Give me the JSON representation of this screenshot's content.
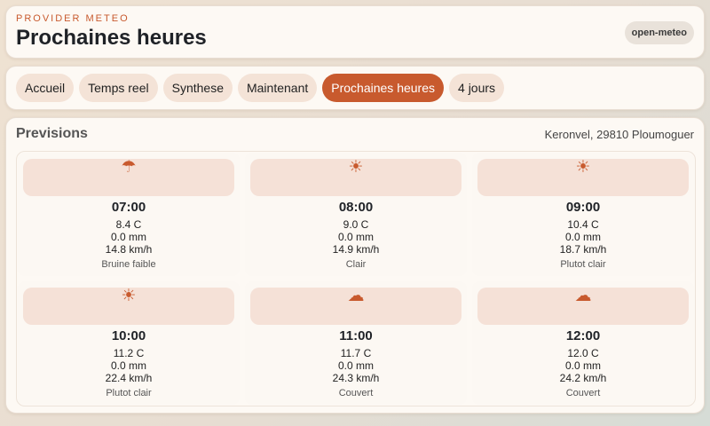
{
  "header": {
    "provider": "PROVIDER METEO",
    "title": "Prochaines heures",
    "badge": "open-meteo"
  },
  "nav": {
    "tabs": [
      {
        "label": "Accueil",
        "active": false
      },
      {
        "label": "Temps reel",
        "active": false
      },
      {
        "label": "Synthese",
        "active": false
      },
      {
        "label": "Maintenant",
        "active": false
      },
      {
        "label": "Prochaines heures",
        "active": true
      },
      {
        "label": "4 jours",
        "active": false
      }
    ]
  },
  "forecast": {
    "title": "Previsions",
    "location": "Keronvel, 29810 Ploumoguer",
    "items": [
      {
        "icon": "umbrella-icon",
        "glyph": "☂",
        "time": "07:00",
        "temp": "8.4 C",
        "rain": "0.0 mm",
        "wind": "14.8 km/h",
        "desc": "Bruine faible"
      },
      {
        "icon": "sun-icon",
        "glyph": "☀",
        "time": "08:00",
        "temp": "9.0 C",
        "rain": "0.0 mm",
        "wind": "14.9 km/h",
        "desc": "Clair"
      },
      {
        "icon": "sun-icon",
        "glyph": "☀",
        "time": "09:00",
        "temp": "10.4 C",
        "rain": "0.0 mm",
        "wind": "18.7 km/h",
        "desc": "Plutot clair"
      },
      {
        "icon": "sun-icon",
        "glyph": "☀",
        "time": "10:00",
        "temp": "11.2 C",
        "rain": "0.0 mm",
        "wind": "22.4 km/h",
        "desc": "Plutot clair"
      },
      {
        "icon": "cloud-icon",
        "glyph": "☁",
        "time": "11:00",
        "temp": "11.7 C",
        "rain": "0.0 mm",
        "wind": "24.3 km/h",
        "desc": "Couvert"
      },
      {
        "icon": "cloud-icon",
        "glyph": "☁",
        "time": "12:00",
        "temp": "12.0 C",
        "rain": "0.0 mm",
        "wind": "24.2 km/h",
        "desc": "Couvert"
      }
    ]
  },
  "colors": {
    "accent": "#c85a2e",
    "card_bg": "#fdf9f4",
    "chip_bg": "#f4e3d7"
  }
}
